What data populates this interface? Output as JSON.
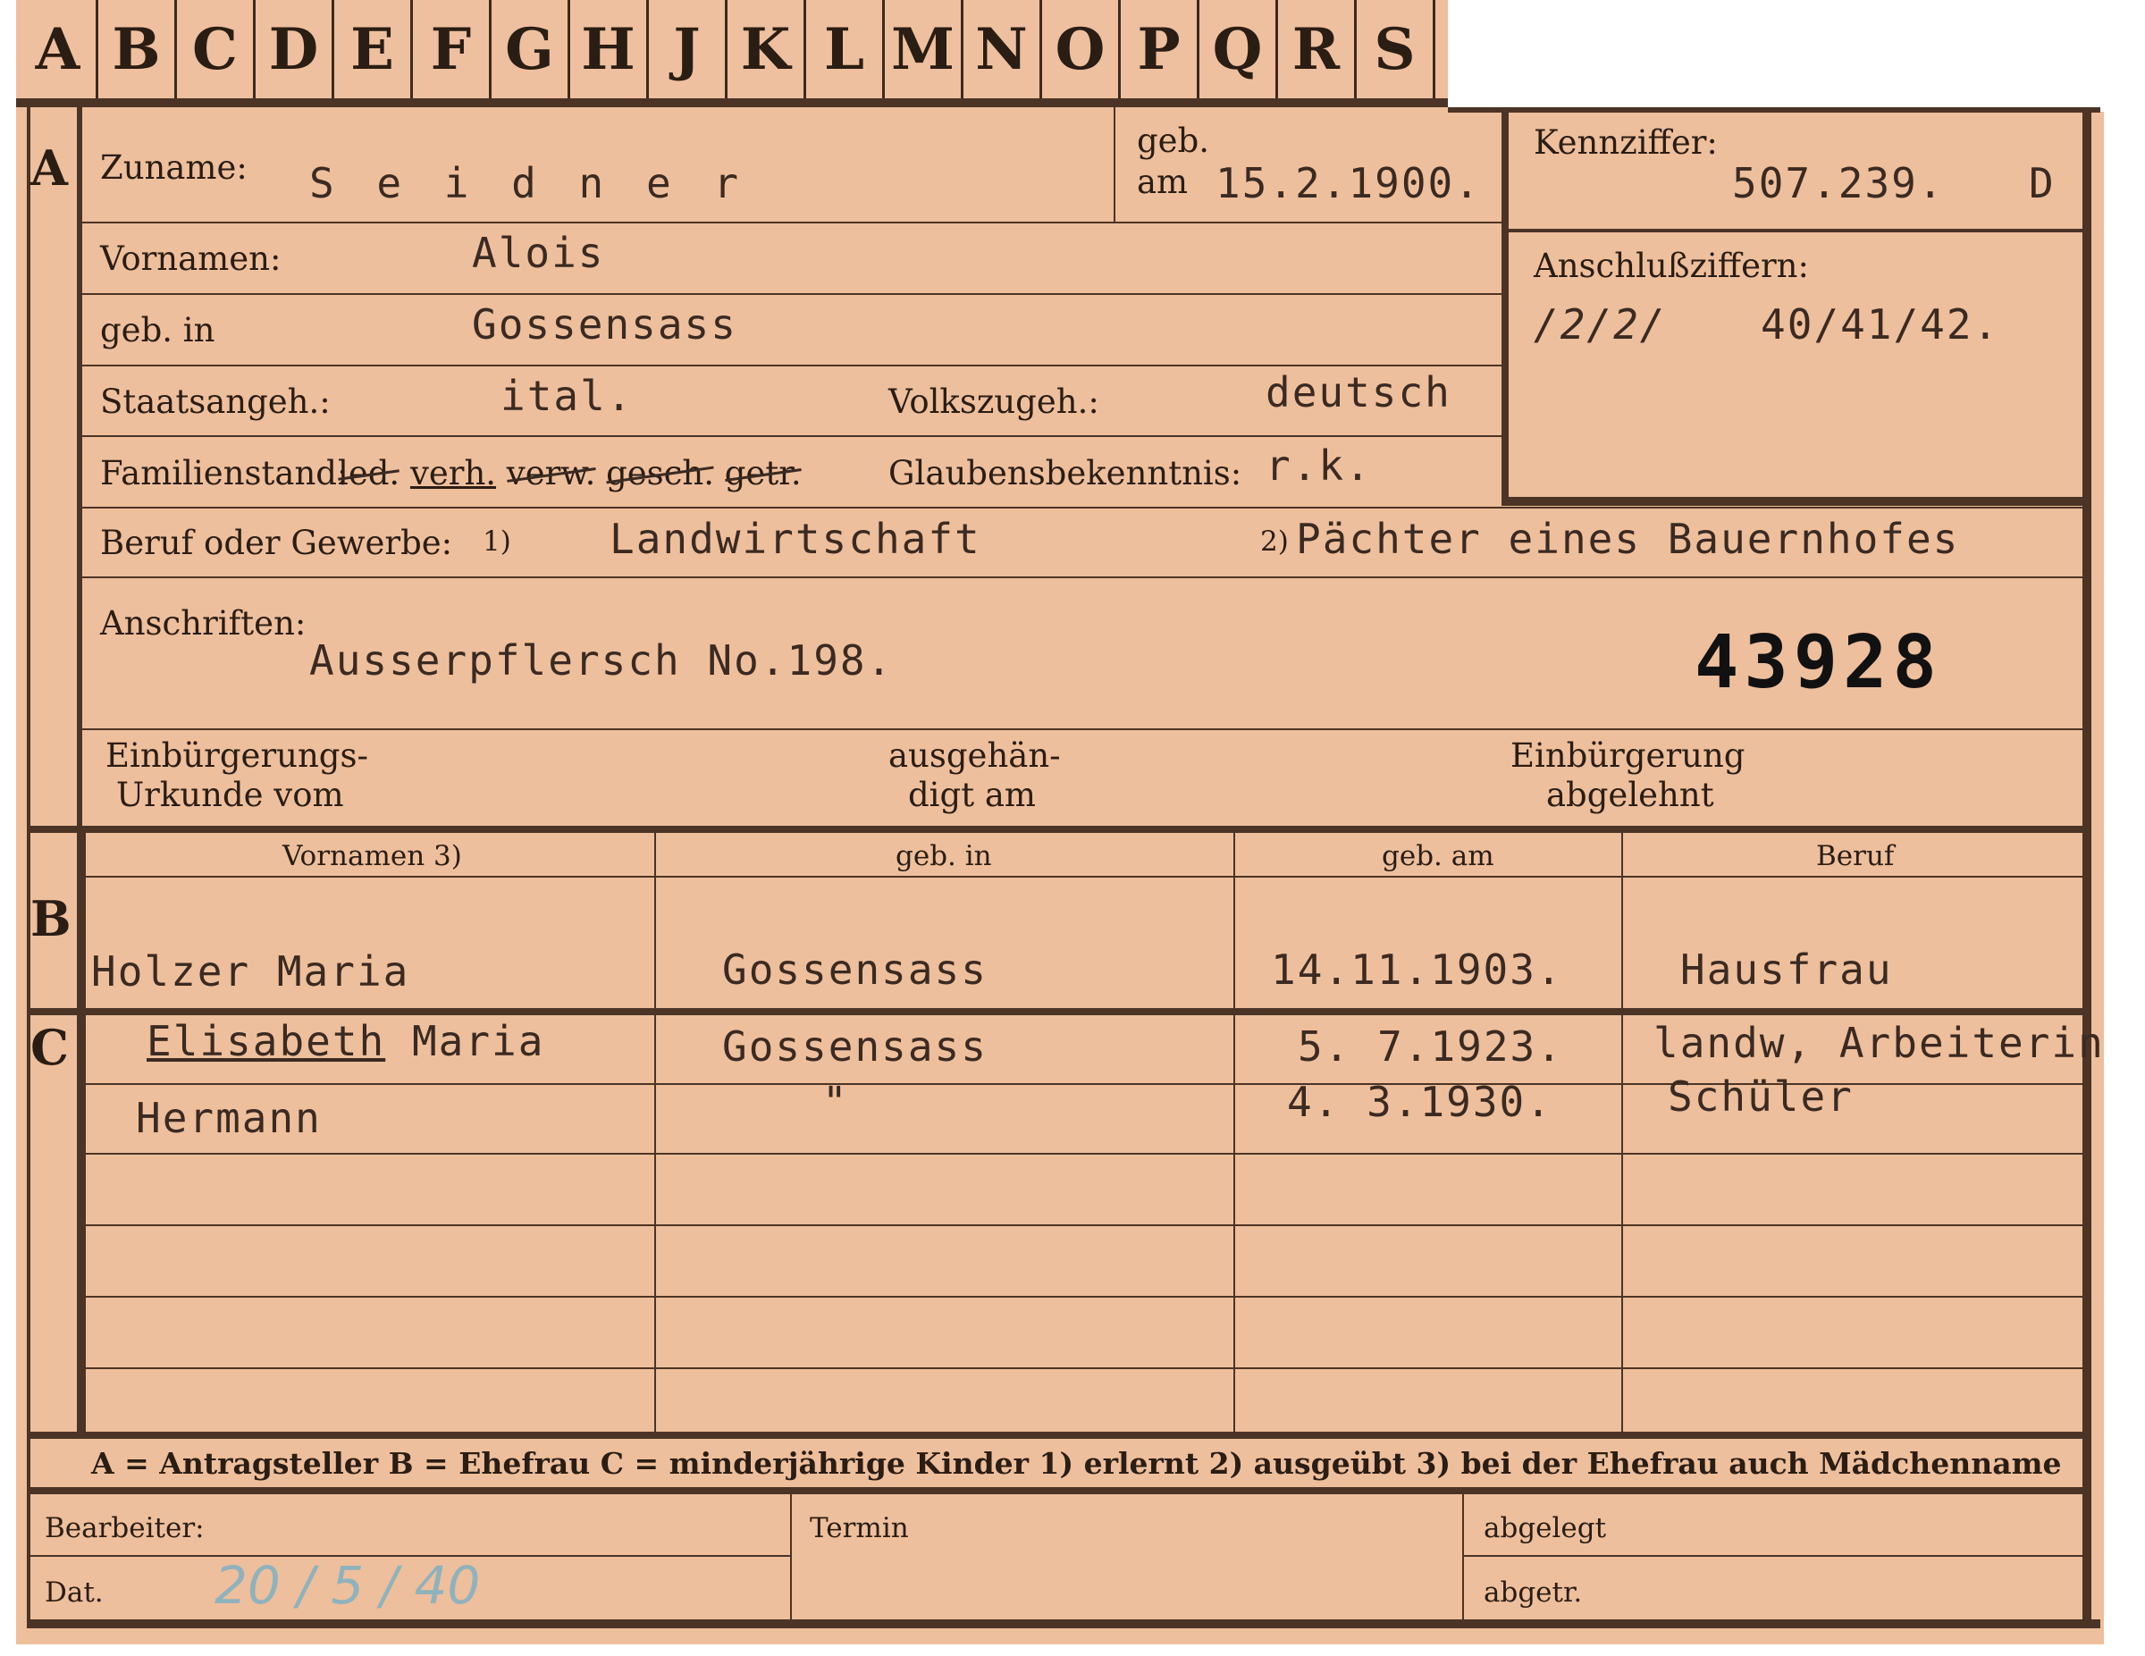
{
  "alphabet_tabs": [
    "A",
    "B",
    "C",
    "D",
    "E",
    "F",
    "G",
    "H",
    "J",
    "K",
    "L",
    "M",
    "N",
    "O",
    "P",
    "Q",
    "R",
    "S"
  ],
  "section_a": {
    "marker": "A",
    "surname_label": "Zuname:",
    "surname": "S e i d n e r",
    "born_label_1": "geb.",
    "born_label_2": "am",
    "born_date": "15.2.1900.",
    "id_label": "Kennziffer:",
    "id_value": "507.239.",
    "id_suffix": "D",
    "linked_label": "Anschlußziffern:",
    "linked_struck": "/2/2/",
    "linked_value": "40/41/42.",
    "first_names_label": "Vornamen:",
    "first_names": "Alois",
    "birthplace_label": "geb. in",
    "birthplace": "Gossensass",
    "citizenship_label": "Staatsangeh.:",
    "citizenship": "ital.",
    "ethnicity_label": "Volkszugeh.:",
    "ethnicity": "deutsch",
    "marital_label": "Familienstand:",
    "marital_options": [
      "led.",
      "verh.",
      "verw.",
      "gesch.",
      "getr."
    ],
    "religion_label": "Glaubensbekenntnis:",
    "religion": "r.k.",
    "occupation_label": "Beruf oder Gewerbe:",
    "occupation_note1": "1)",
    "occupation_learned": "Landwirtschaft",
    "occupation_note2": "2)",
    "occupation_practiced": "Pächter eines Bauernhofes",
    "address_label": "Anschriften:",
    "address": "Ausserpflersch No.198.",
    "file_number": "43928",
    "naturalization_label_1": "Einbürgerungs-",
    "naturalization_label_2": "Urkunde vom",
    "issued_label_1": "ausgehän-",
    "issued_label_2": "digt am",
    "rejected_label_1": "Einbürgerung",
    "rejected_label_2": "abgelehnt"
  },
  "table_headers": {
    "first_names": "Vornamen 3)",
    "birthplace": "geb. in",
    "birthdate": "geb. am",
    "occupation": "Beruf"
  },
  "section_b": {
    "marker": "B",
    "name": "Holzer Maria",
    "birthplace": "Gossensass",
    "birthdate": "14.11.1903.",
    "occupation": "Hausfrau"
  },
  "section_c": {
    "marker": "C",
    "children": [
      {
        "name_underlined": "Elisabeth",
        "name_rest": "Maria",
        "birthplace": "Gossensass",
        "birthdate": "5. 7.1923.",
        "occupation": "landw, Arbeiterin"
      },
      {
        "name_underlined": "",
        "name_rest": "Hermann",
        "birthplace": "\"",
        "birthdate": "4. 3.1930.",
        "occupation": "Schüler"
      }
    ]
  },
  "legend": "A = Antragsteller   B = Ehefrau   C = minderjährige Kinder   1) erlernt   2) ausgeübt   3) bei der Ehefrau auch Mädchenname",
  "footer": {
    "processor_label": "Bearbeiter:",
    "date_label": "Dat.",
    "date_handwritten": "20 / 5 / 40",
    "deadline_label": "Termin",
    "filed_label": "abgelegt",
    "removed_label": "abgetr."
  },
  "colors": {
    "card": "#eebf9c",
    "ink": "#2a1d14",
    "rule": "#4b3426",
    "pencil": "#8fb2bd"
  }
}
